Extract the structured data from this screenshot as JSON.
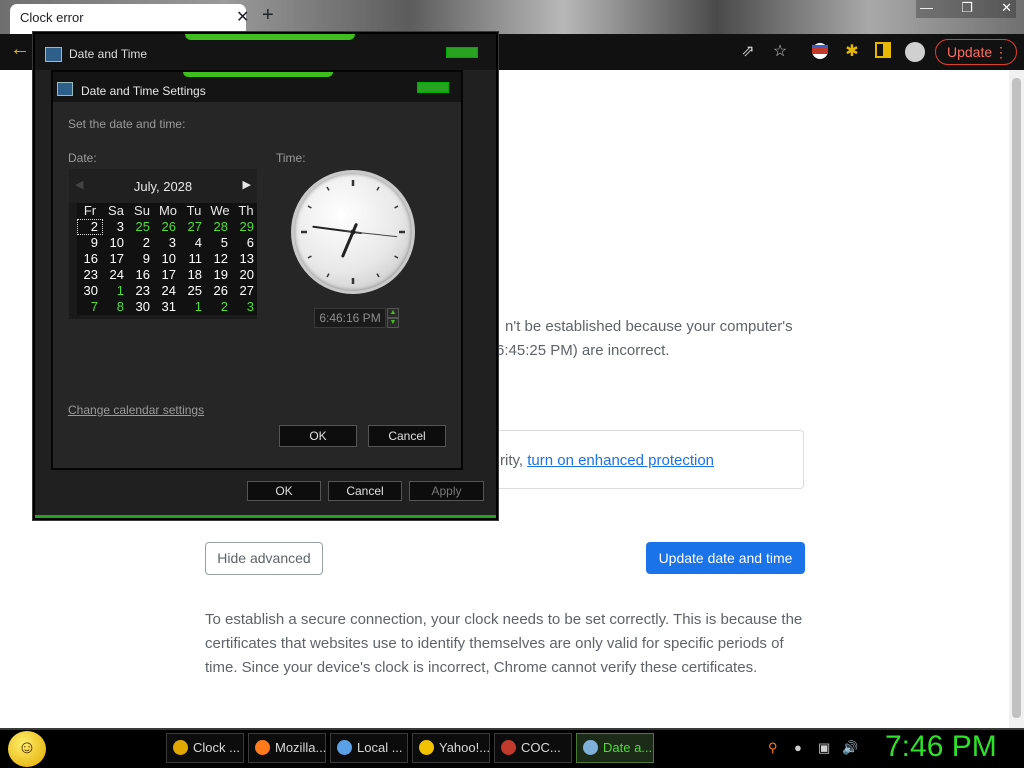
{
  "browser": {
    "tab_title": "Clock error",
    "tab_close": "✕",
    "new_tab": "+",
    "window_controls": [
      "—",
      "❐",
      "✕"
    ],
    "update_label": "Update",
    "update_menu": "⋮"
  },
  "page": {
    "error_line1": "n't be established because your computer's",
    "error_line2": "6:45:25 PM) are incorrect.",
    "enhanced_prefix": "rity, ",
    "enhanced_link": "turn on enhanced protection",
    "hide_advanced": "Hide advanced",
    "update_date_time": "Update date and time",
    "explanation": "To establish a secure connection, your clock needs to be set correctly. This is because the certificates that websites use to identify themselves are only valid for specific periods of time. Since your device's clock is incorrect, Chrome cannot verify these certificates."
  },
  "outer_dialog": {
    "title": "Date and Time",
    "ok": "OK",
    "cancel": "Cancel",
    "apply": "Apply"
  },
  "inner_dialog": {
    "title": "Date and Time Settings",
    "set_label": "Set the date and time:",
    "date_label": "Date:",
    "time_label": "Time:",
    "month": "July, 2028",
    "prev_arrow": "◀",
    "next_arrow": "▶",
    "weekdays": [
      "Fr",
      "Sa",
      "Su",
      "Mo",
      "Tu",
      "We",
      "Th"
    ],
    "weeks": [
      [
        "2",
        "3",
        "25",
        "26",
        "27",
        "28",
        "29"
      ],
      [
        "9",
        "10",
        "2",
        "3",
        "4",
        "5",
        "6"
      ],
      [
        "16",
        "17",
        "9",
        "10",
        "11",
        "12",
        "13"
      ],
      [
        "23",
        "24",
        "16",
        "17",
        "18",
        "19",
        "20"
      ],
      [
        "30",
        "1",
        "23",
        "24",
        "25",
        "26",
        "27"
      ],
      [
        "7",
        "8",
        "30",
        "31",
        "1",
        "2",
        "3"
      ]
    ],
    "other_month_cells": [
      [
        0,
        2
      ],
      [
        0,
        3
      ],
      [
        0,
        4
      ],
      [
        0,
        5
      ],
      [
        0,
        6
      ],
      [
        4,
        1
      ],
      [
        5,
        0
      ],
      [
        5,
        1
      ],
      [
        5,
        4
      ],
      [
        5,
        5
      ],
      [
        5,
        6
      ]
    ],
    "selected_cell": [
      0,
      0
    ],
    "time_value": "6:46:16 PM",
    "clock_time": {
      "hours": 6,
      "minutes": 46,
      "seconds": 16
    },
    "spin_up": "▲",
    "spin_down": "▼",
    "change_calendar": "Change calendar settings",
    "ok": "OK",
    "cancel": "Cancel"
  },
  "taskbar": {
    "items": [
      {
        "label": "Clock ...",
        "icon": "chrome-icon",
        "color": "#e0a800"
      },
      {
        "label": "Mozilla...",
        "icon": "firefox-icon",
        "color": "#ff7a1a"
      },
      {
        "label": "Local ...",
        "icon": "folder-icon",
        "color": "#5aa0e6"
      },
      {
        "label": "Yahoo!...",
        "icon": "smiley-icon",
        "color": "#f2c200"
      },
      {
        "label": "COC...",
        "icon": "app-icon",
        "color": "#c0392b"
      },
      {
        "label": "Date a...",
        "icon": "calendar-icon",
        "color": "#7fb0d9"
      }
    ],
    "clock": "7:46 PM"
  },
  "colors": {
    "accent_green": "#27a321",
    "chrome_blue": "#1a73e8",
    "update_red": "#e03c31"
  }
}
